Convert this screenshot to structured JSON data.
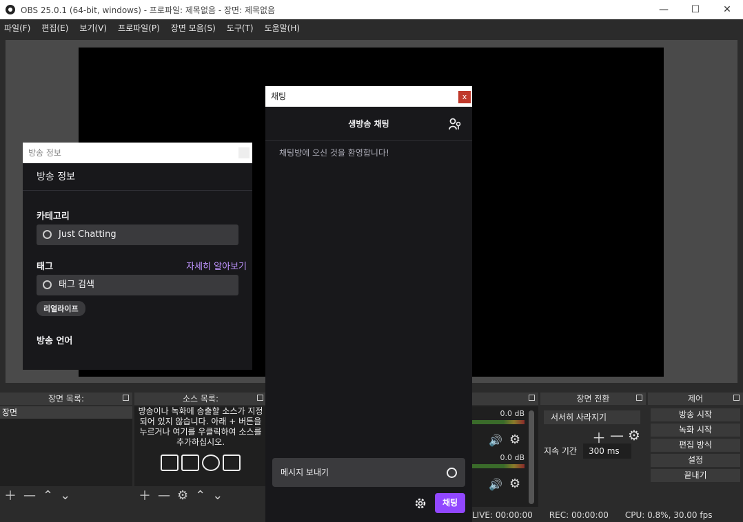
{
  "window": {
    "title": "OBS 25.0.1 (64-bit, windows) - 프로파일: 제목없음 - 장면: 제목없음"
  },
  "menu": [
    "파일(F)",
    "편집(E)",
    "보기(V)",
    "프로파일(P)",
    "장면 모음(S)",
    "도구(T)",
    "도움말(H)"
  ],
  "scenes": {
    "title": "장면 목록:",
    "items": [
      "장면"
    ]
  },
  "sources": {
    "title": "소스 목록:",
    "empty_text": "방송이나 녹화에 송출할 소스가 지정되어 있지 않습니다. 아래 + 버튼을 누르거나 여기를 우클릭하여 소스를 추가하십시오."
  },
  "mixer": {
    "level_1": "0.0 dB",
    "level_2": "0.0 dB"
  },
  "transitions": {
    "title": "장면 전환",
    "selected": "서서히 사라지기",
    "duration_label": "지속 기간",
    "duration": "300 ms"
  },
  "controls": {
    "title": "제어",
    "buttons": [
      "방송 시작",
      "녹화 시작",
      "편집 방식",
      "설정",
      "끝내기"
    ]
  },
  "status": {
    "live": "LIVE: 00:00:00",
    "rec": "REC: 00:00:00",
    "cpu": "CPU: 0.8%, 30.00 fps"
  },
  "info_panel": {
    "window_title": "방송 정보",
    "header": "방송 정보",
    "category_label": "카테고리",
    "category_value": "Just Chatting",
    "tags_label": "태그",
    "learn_more": "자세히 알아보기",
    "tag_search_placeholder": "태그 검색",
    "tag_chip": "리얼라이프",
    "language_label": "방송 언어"
  },
  "chat_panel": {
    "window_title": "채팅",
    "close": "x",
    "header": "생방송 채팅",
    "welcome": "채팅방에 오신 것을 환영합니다!",
    "input_placeholder": "메시지 보내기",
    "send_label": "채팅"
  },
  "colors": {
    "accent": "#9147ff",
    "link": "#bf94ff",
    "close_red": "#c0392b"
  }
}
